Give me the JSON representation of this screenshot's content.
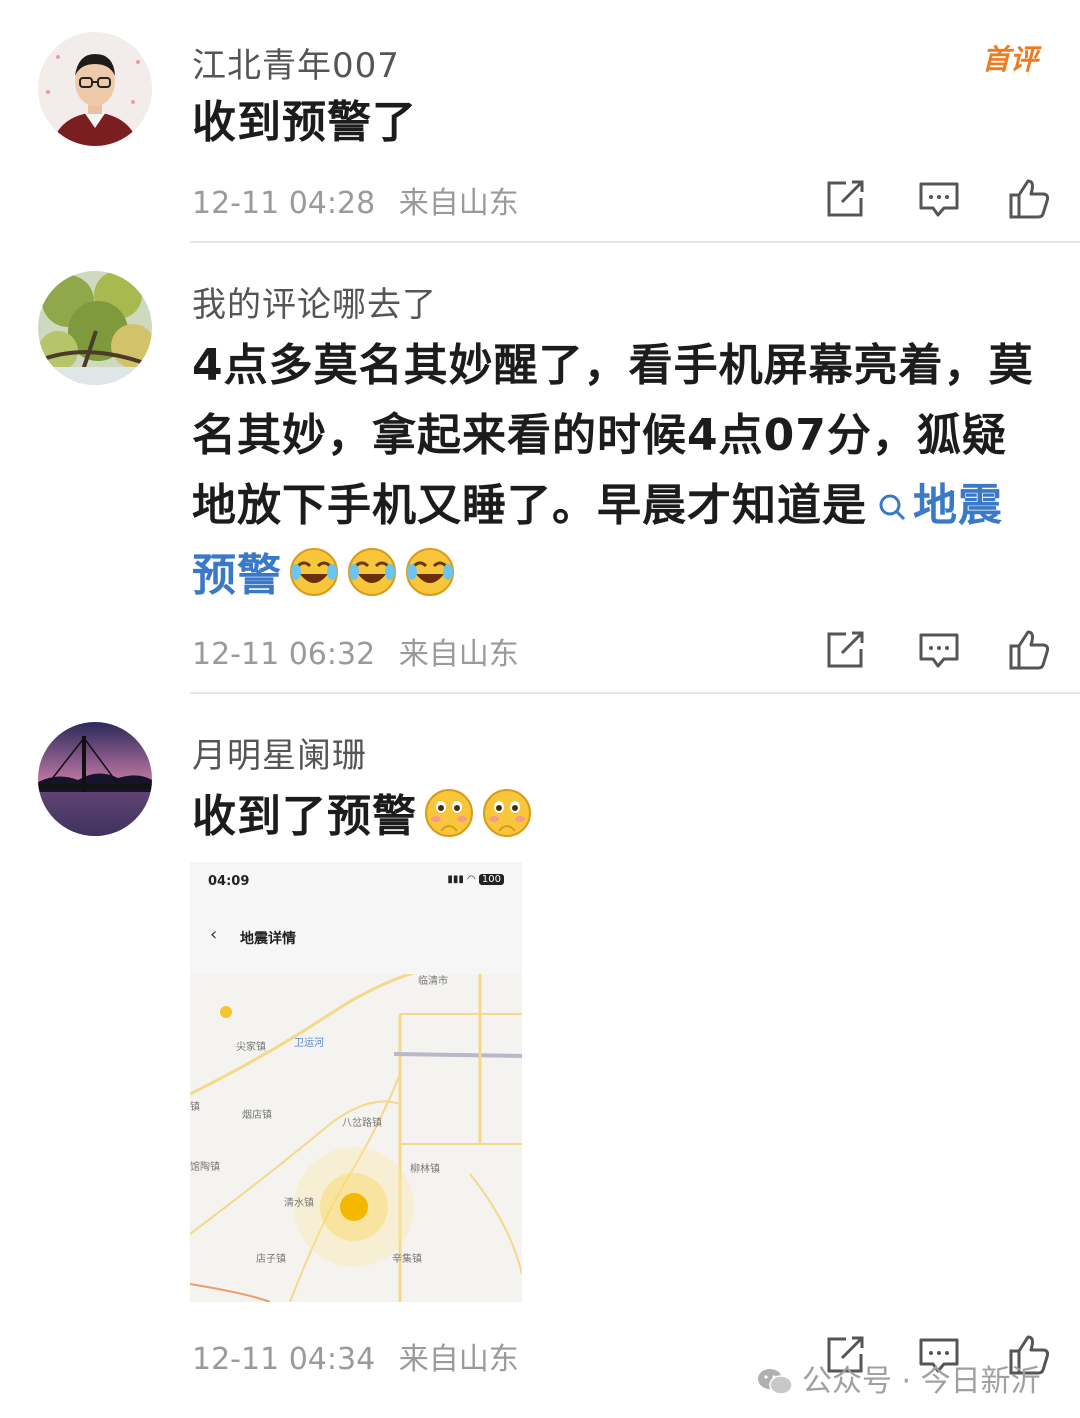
{
  "badge": {
    "label": "首评"
  },
  "comments": [
    {
      "username": "江北青年007",
      "text": "收到预警了",
      "time": "12-11 04:28",
      "location": "来自山东"
    },
    {
      "username": "我的评论哪去了",
      "text": "4点多莫名其妙醒了，看手机屏幕亮着，莫名其妙，拿起来看的时候4点07分，狐疑地放下手机又睡了。早晨才知道是",
      "topic_icon": "search-icon",
      "topic": "地震预警",
      "emojis": [
        "laugh-cry-emoji",
        "laugh-cry-emoji",
        "laugh-cry-emoji"
      ],
      "time": "12-11 06:32",
      "location": "来自山东"
    },
    {
      "username": "月明星阑珊",
      "text": "收到了预警",
      "emojis": [
        "shy-emoji",
        "shy-emoji"
      ],
      "time": "12-11 04:34",
      "location": "来自山东"
    }
  ],
  "attached_screenshot": {
    "status_time": "04:09",
    "status_right": "100",
    "back_icon": "chevron-left-icon",
    "title": "地震详情",
    "map_labels": [
      "临清市",
      "尖家镇",
      "卫运河",
      "烟店镇",
      "八岔路镇",
      "馆陶镇",
      "柳林镇",
      "清水镇",
      "店子镇",
      "辛集镇",
      "镇"
    ],
    "epicenter_color": "#f5b800"
  },
  "action_icons": [
    "share-icon",
    "comment-icon",
    "like-icon"
  ],
  "watermark": {
    "icon": "wechat-icon",
    "text": "公众号 · 今日新沂"
  },
  "colors": {
    "badge": "#f07a1f",
    "link": "#3a78c8",
    "meta": "#9a9a9a"
  }
}
